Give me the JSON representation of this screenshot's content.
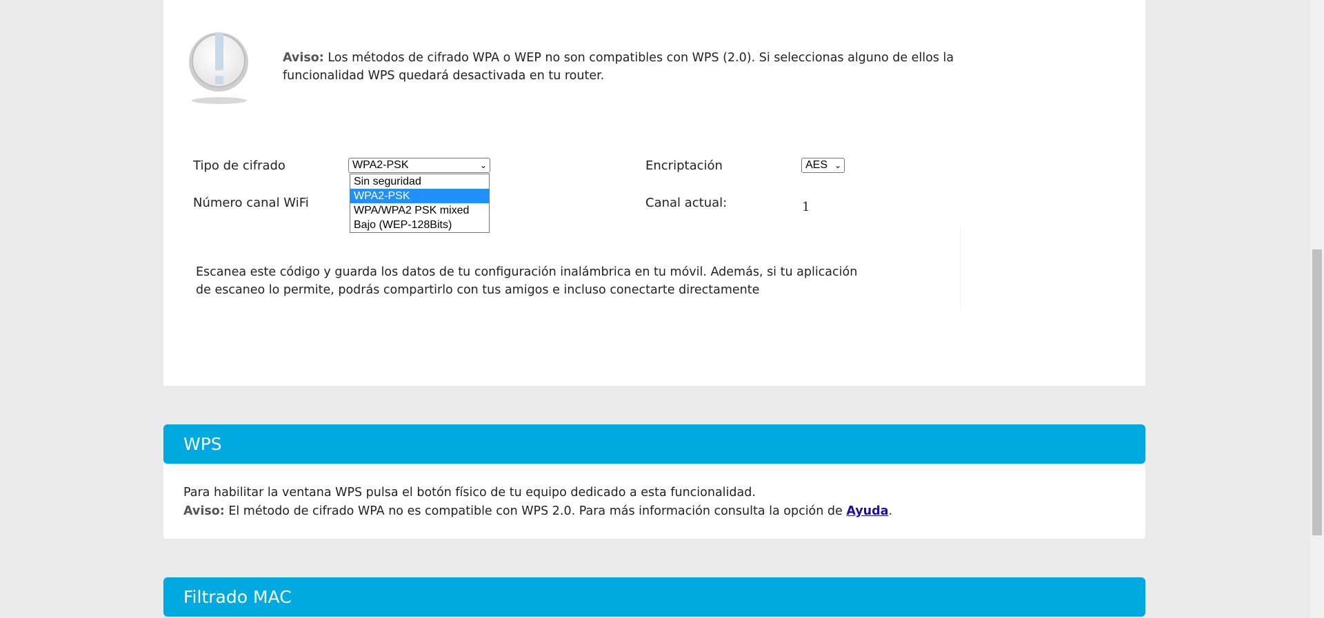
{
  "warning": {
    "label": "Aviso:",
    "text": " Los métodos de cifrado WPA o WEP no son compatibles con WPS (2.0). Si seleccionas alguno de ellos la funcionalidad WPS quedará desactivada en tu router."
  },
  "form": {
    "cipher_type_label": "Tipo de cifrado",
    "cipher_type_value": "WPA2-PSK",
    "cipher_options": [
      "Sin seguridad",
      "WPA2-PSK",
      "WPA/WPA2 PSK mixed",
      "Bajo (WEP-128Bits)"
    ],
    "selected_option_index": 1,
    "encryption_label": "Encriptación",
    "encryption_value": "AES",
    "channel_label": "Número canal WiFi",
    "current_channel_label": "Canal actual:",
    "current_channel_value": "1"
  },
  "qr": {
    "text": "Escanea este código y guarda los datos de tu configuración inalámbrica en tu móvil. Además, si tu aplicación de escaneo lo permite, podrás compartirlo con tus amigos e incluso conectarte directamente"
  },
  "wps": {
    "title": "WPS",
    "line1": "Para habilitar la ventana WPS pulsa el botón físico de tu equipo dedicado a esta funcionalidad.",
    "aviso_label": "Aviso:",
    "line2": " El método de cifrado WPA no es compatible con WPS 2.0. Para más información consulta la opción de ",
    "help_link": "Ayuda",
    "line2_end": "."
  },
  "mac_filter": {
    "title": "Filtrado MAC"
  },
  "colors": {
    "accent": "#00a9e0",
    "page_bg": "#ebebeb",
    "selected_option": "#1e90ff",
    "link": "#1a0dab"
  }
}
